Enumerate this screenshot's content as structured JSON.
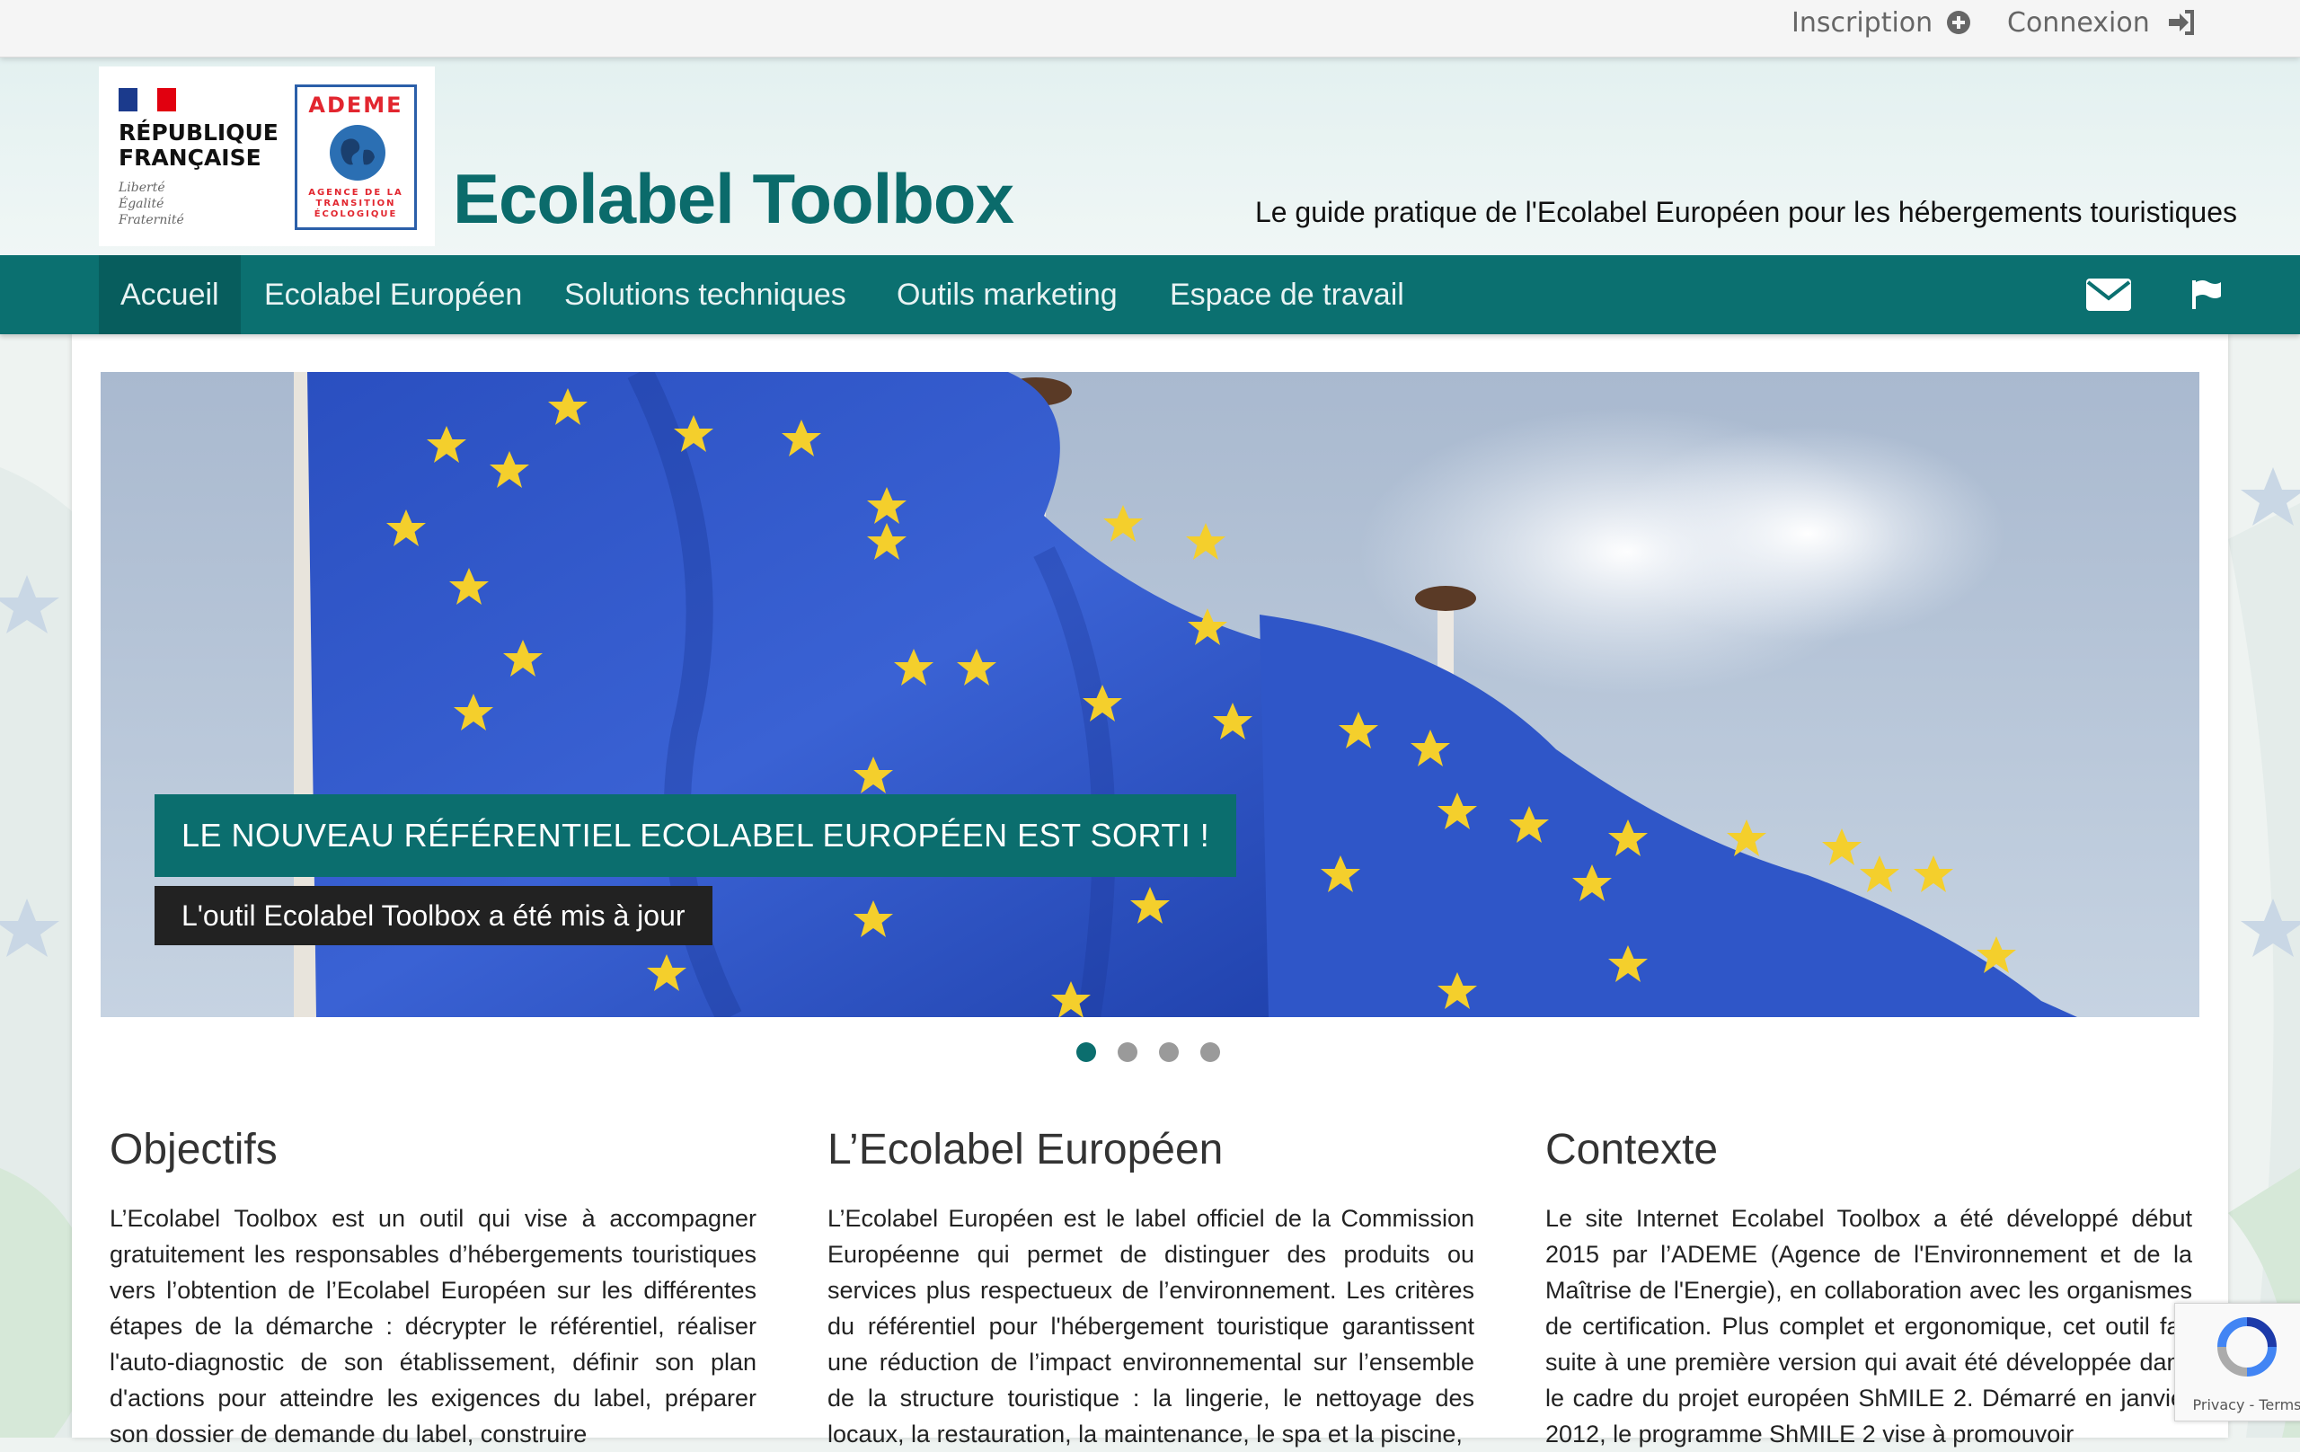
{
  "topbar": {
    "signup_label": "Inscription",
    "login_label": "Connexion"
  },
  "header": {
    "republique_line1": "RÉPUBLIQUE",
    "republique_line2": "FRANÇAISE",
    "motto_1": "Liberté",
    "motto_2": "Égalité",
    "motto_3": "Fraternité",
    "ademe_title": "ADEME",
    "ademe_sub_1": "AGENCE DE LA",
    "ademe_sub_2": "TRANSITION",
    "ademe_sub_3": "ÉCOLOGIQUE",
    "site_title": "Ecolabel Toolbox",
    "tagline": "Le guide pratique de l'Ecolabel Européen pour les hébergements touristiques"
  },
  "nav": {
    "items": [
      {
        "label": "Accueil"
      },
      {
        "label": "Ecolabel Européen"
      },
      {
        "label": "Solutions techniques"
      },
      {
        "label": "Outils marketing"
      },
      {
        "label": "Espace de travail"
      }
    ]
  },
  "carousel": {
    "caption_title": "LE NOUVEAU RÉFÉRENTIEL ECOLABEL EUROPÉEN EST SORTI !",
    "caption_sub": "L'outil Ecolabel Toolbox a été mis à jour",
    "slides": 4,
    "active_slide": 1
  },
  "columns": [
    {
      "title": "Objectifs",
      "text": "L’Ecolabel Toolbox est un outil qui vise à accompagner gratuitement les responsables d’hébergements touristiques vers l’obtention de l’Ecolabel Européen sur les différentes étapes de la démarche : décrypter le référentiel, réaliser l'auto-diagnostic de son établissement, définir son plan d'actions pour atteindre les exigences du label, préparer son dossier de demande du label, construire"
    },
    {
      "title": "L’Ecolabel Européen",
      "text": "L’Ecolabel Européen est le label officiel de la Commission Européenne qui permet de distinguer des produits ou services plus respectueux de l’environnement. Les critères du référentiel pour l'hébergement touristique garantissent une réduction de l’impact environnemental sur l’ensemble de la structure touristique : la lingerie, le nettoyage des locaux, la restauration, la maintenance, le spa et la piscine,"
    },
    {
      "title": "Contexte",
      "text": "Le site Internet Ecolabel Toolbox a été développé début 2015 par l’ADEME (Agence de l'Environnement et de la Maîtrise de l'Energie), en collaboration avec les organismes de certification. Plus complet et ergonomique, cet outil fait suite à une première version qui avait été développée dans le cadre du projet européen ShMILE 2. Démarré en janvier 2012, le programme ShMILE 2 vise à promouvoir"
    }
  ],
  "recaptcha": {
    "label": "Privacy - Terms"
  },
  "colors": {
    "brand": "#0b7070",
    "nav_active": "#075d5d",
    "title": "#0b6b6b"
  }
}
